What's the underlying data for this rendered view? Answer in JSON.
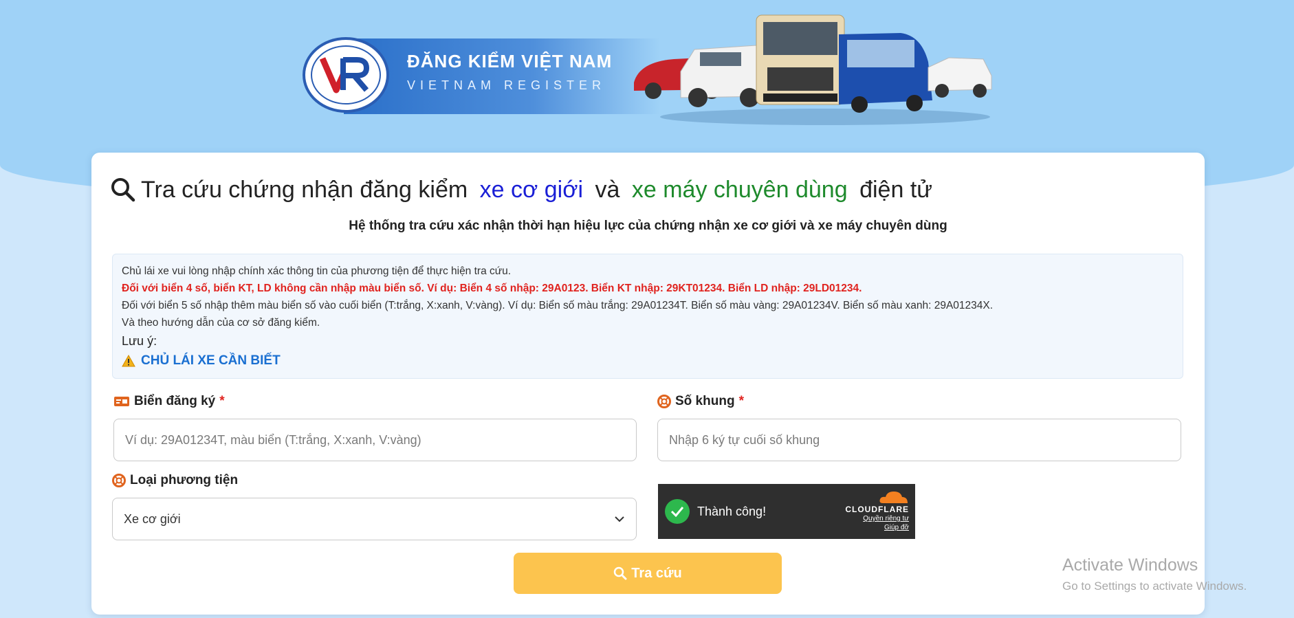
{
  "banner": {
    "title": "ĐĂNG KIỂM VIỆT NAM",
    "subtitle": "VIETNAM REGISTER",
    "seal_icon": "vr-seal-logo",
    "seal_text": "ĐĂNG KIỂM VIỆT NAM · VIET NAM REGISTER"
  },
  "heading": {
    "icon": "search-icon",
    "part1": "Tra cứu chứng nhận đăng kiểm ",
    "part2": "xe cơ giới",
    "part3": " và ",
    "part4": "xe máy chuyên dùng",
    "part5": " điện tử"
  },
  "subtitle": "Hệ thống tra cứu xác nhận thời hạn hiệu lực của chứng nhận xe cơ giới và xe máy chuyên dùng",
  "notice": {
    "line1": "Chủ lái xe vui lòng nhập chính xác thông tin của phương tiện để thực hiện tra cứu.",
    "line2": "Đối với biển 4 số, biển KT, LD không cần nhập màu biển số. Ví dụ: Biển 4 số nhập: 29A0123. Biển KT nhập: 29KT01234. Biển LD nhập: 29LD01234.",
    "line3": "Đối với biển 5 số nhập thêm màu biển số vào cuối biển (T:trắng, X:xanh, V:vàng). Ví dụ: Biển số màu trắng: 29A01234T. Biển số màu vàng: 29A01234V. Biển số màu xanh: 29A01234X.",
    "line4": "Và theo hướng dẫn của cơ sở đăng kiểm.",
    "note_label": "Lưu ý:",
    "know_link": "CHỦ LÁI XE CẦN BIẾT"
  },
  "form": {
    "plate": {
      "label": "Biển đăng ký",
      "required": "*",
      "placeholder": "Ví dụ: 29A01234T, màu biển (T:trắng, X:xanh, V:vàng)",
      "value": ""
    },
    "frame": {
      "label": "Số khung",
      "required": "*",
      "placeholder": "Nhập 6 ký tự cuối số khung",
      "value": ""
    },
    "vehicle_type": {
      "label": "Loại phương tiện",
      "selected": "Xe cơ giới"
    },
    "submit_label": "Tra cứu"
  },
  "captcha": {
    "status": "Thành công!",
    "brand": "CLOUDFLARE",
    "privacy_link": "Quyền riêng tư",
    "help_link": "Giúp đỡ"
  },
  "watermark": {
    "title": "Activate Windows",
    "subtitle": "Go to Settings to activate Windows."
  },
  "colors": {
    "accent_blue": "#1a1fd6",
    "accent_green": "#1e8a2c",
    "required_red": "#e0231f",
    "button_yellow": "#fcc44e",
    "link_blue": "#1a6fd1"
  }
}
